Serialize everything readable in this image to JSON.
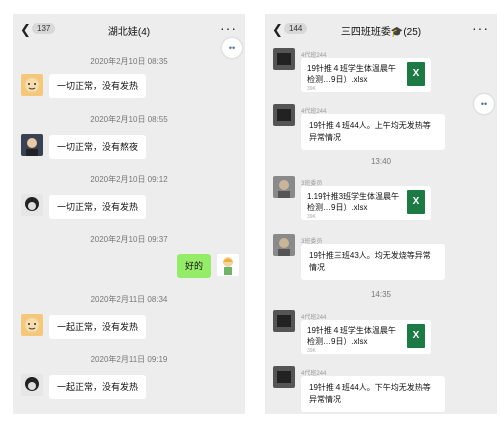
{
  "left_phone": {
    "badge": "137",
    "title": "湖北娃(4)",
    "more": "···",
    "float_icon": "••",
    "messages": [
      {
        "time": "2020年2月10日 08:35",
        "text": "一切正常，没有发热"
      },
      {
        "time": "2020年2月10日 08:55",
        "text": "一切正常，没有熬夜"
      },
      {
        "time": "2020年2月10日 09:12",
        "text": "一切正常，没有发热"
      },
      {
        "time": "2020年2月10日 09:37",
        "text": "好的"
      },
      {
        "time": "2020年2月11日 08:34",
        "text": "一起正常，没有发热"
      },
      {
        "time": "2020年2月11日 09:19",
        "text": "一起正常，没有发热"
      }
    ]
  },
  "right_phone": {
    "badge": "144",
    "title": "三四班班委🎓(25)",
    "more": "···",
    "float_icon": "••",
    "messages": [
      {
        "sender": "4代班244",
        "file": "19针推４班学生体温晨午检测…9日）.xlsx",
        "size": "39K"
      },
      {
        "sender": "4代班244",
        "text": "19针推４班44人。上午均无发热等异常情况"
      },
      {
        "time": "13:40"
      },
      {
        "sender": "3班委员",
        "file": "1.19针推3班学生体温晨午检测…9日）.xlsx",
        "size": "39K"
      },
      {
        "sender": "3班委员",
        "text": "19针推三班43人。均无发烧等异常情况"
      },
      {
        "time": "14:35"
      },
      {
        "sender": "4代班244",
        "file": "19针推４班学生体温晨午检测…9日）.xlsx",
        "size": "39K"
      },
      {
        "sender": "4代班244",
        "text": "19针推４班44人。下午均无发热等异常情况"
      }
    ]
  },
  "icons": {
    "back": "chevron-left-icon",
    "more": "more-dots-icon",
    "file": "excel-file-icon"
  },
  "colors": {
    "own_bubble": "#95ec69",
    "chat_bg": "#ededed",
    "excel": "#1d7a45"
  }
}
